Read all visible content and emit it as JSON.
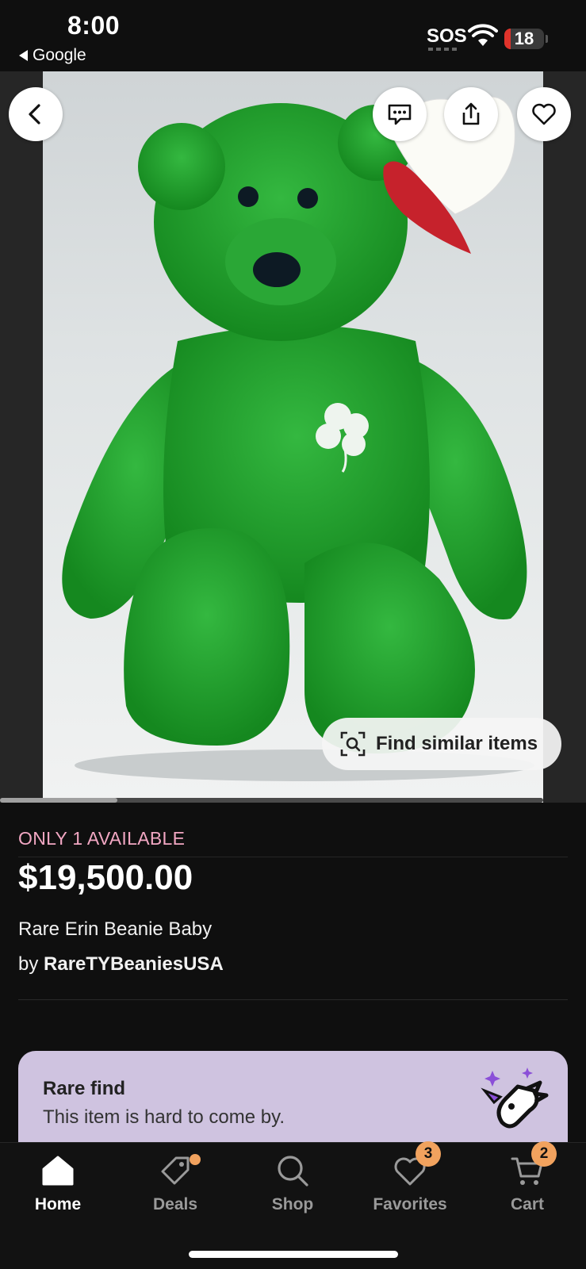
{
  "status_bar": {
    "time": "8:00",
    "back_app": "Google",
    "sos": "SOS",
    "battery": "18"
  },
  "image": {
    "find_similar_label": "Find similar items"
  },
  "listing": {
    "availability": "ONLY 1 AVAILABLE",
    "price": "$19,500.00",
    "title": "Rare Erin Beanie Baby",
    "by_prefix": "by ",
    "seller": "RareTYBeaniesUSA"
  },
  "rare_card": {
    "title": "Rare find",
    "text": "This item is hard to come by."
  },
  "tabs": [
    {
      "label": "Home",
      "icon": "home-icon",
      "active": true
    },
    {
      "label": "Deals",
      "icon": "tag-icon",
      "dot": true
    },
    {
      "label": "Shop",
      "icon": "search-icon"
    },
    {
      "label": "Favorites",
      "icon": "heart-icon",
      "badge": "3"
    },
    {
      "label": "Cart",
      "icon": "cart-icon",
      "badge": "2"
    }
  ],
  "colors": {
    "availability": "#f2a7c3",
    "badge": "#f1a25e",
    "rare_card": "#cfc3e0",
    "bear_green": "#1f9a2e"
  }
}
